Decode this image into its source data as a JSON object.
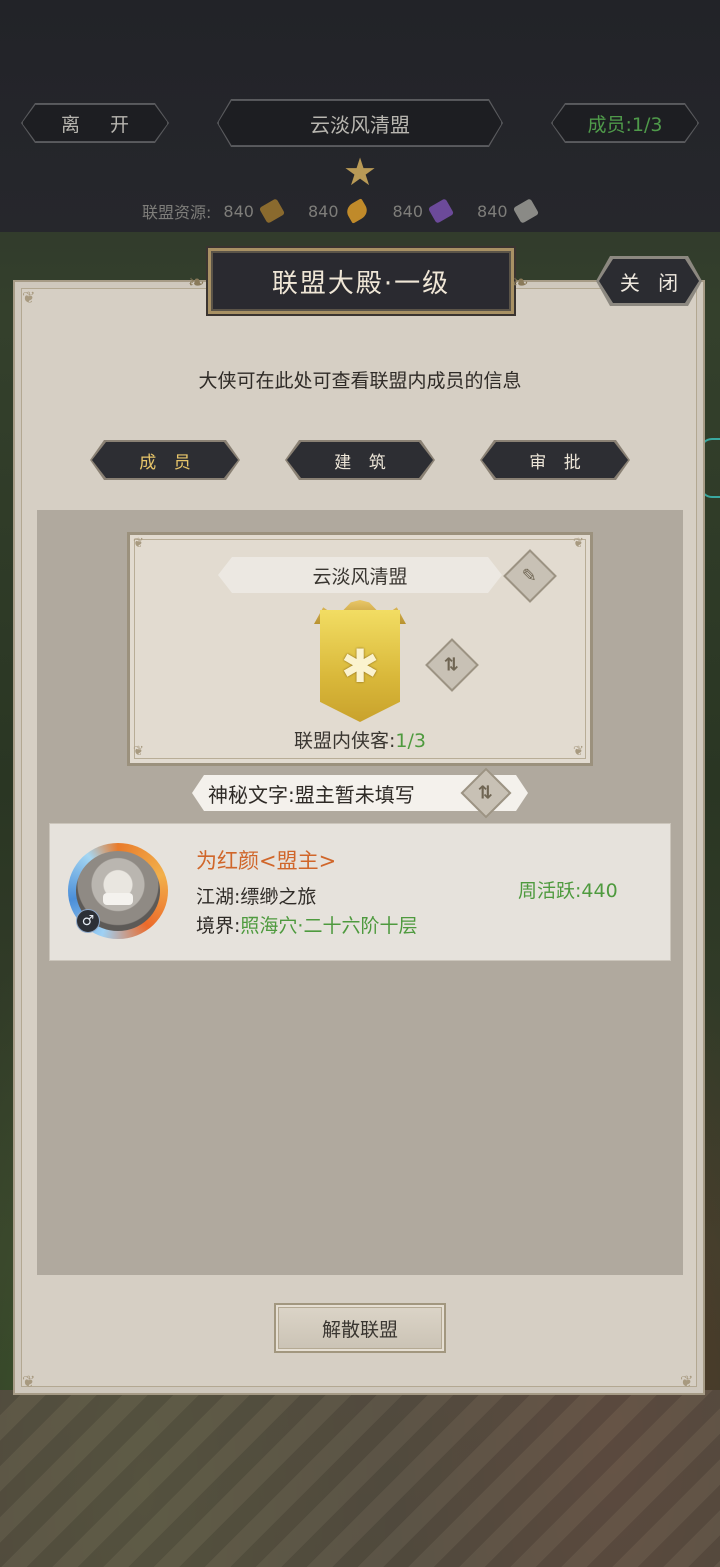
{
  "header": {
    "leave_label": "离 开",
    "alliance_name": "云淡风清盟",
    "members_label": "成员:1/3",
    "resources_label": "联盟资源:",
    "resources": [
      {
        "value": "840",
        "icon": "wood-icon",
        "color": "#8a6a2e"
      },
      {
        "value": "840",
        "icon": "grain-icon",
        "color": "#c08a2a"
      },
      {
        "value": "840",
        "icon": "crystal-icon",
        "color": "#6c4a9a"
      },
      {
        "value": "840",
        "icon": "scroll-icon",
        "color": "#8a8a86"
      }
    ]
  },
  "panel": {
    "title": "联盟大殿·一级",
    "close_label": "关 闭",
    "subtitle": "大侠可在此处可查看联盟内成员的信息",
    "tabs": [
      {
        "label": "成 员",
        "active": true
      },
      {
        "label": "建 筑",
        "active": false
      },
      {
        "label": "审 批",
        "active": false
      }
    ]
  },
  "emblem": {
    "name": "云淡风清盟",
    "members_label": "联盟内侠客:",
    "members_value": "1/3",
    "motto": "神秘文字:盟主暂未填写"
  },
  "member_list": [
    {
      "name": "为红颜<盟主>",
      "jianghu_label": "江湖:",
      "jianghu_value": "缥缈之旅",
      "realm_label": "境界:",
      "realm_value": "照海穴·二十六阶十层",
      "activity": "周活跃:440",
      "gender_icon": "male-icon"
    }
  ],
  "footer": {
    "disband_label": "解散联盟"
  },
  "colors": {
    "accent_green": "#4e9a3e",
    "leader_orange": "#d0662a",
    "panel_bg": "#d6cfc4"
  }
}
